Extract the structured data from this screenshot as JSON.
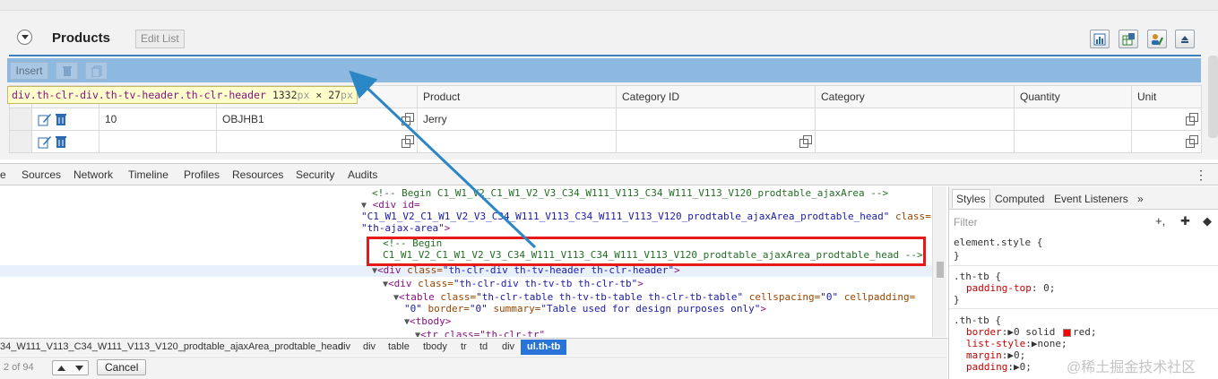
{
  "app": {
    "title": "Products",
    "edit_list_label": "Edit List",
    "insert_label": "Insert",
    "tooltip": {
      "selector": "div.th-clr-div.th-tv-header.th-clr-header",
      "width": "1332",
      "height": "27",
      "unit": "px",
      "times": "×"
    },
    "table": {
      "columns": [
        "Product",
        "Category ID",
        "Category",
        "Quantity",
        "Unit"
      ],
      "rows": [
        {
          "num": "10",
          "id": "OBJHB1",
          "product": "Jerry"
        },
        {
          "num": "",
          "id": "",
          "product": ""
        }
      ]
    }
  },
  "devtools": {
    "tabs": [
      "e",
      "Sources",
      "Network",
      "Timeline",
      "Profiles",
      "Resources",
      "Security",
      "Audits"
    ],
    "menu_icon": "⋮",
    "dom": {
      "l1": "<!-- Begin C1_W1_V2_C1_W1_V2_V3_C34_W111_V113_C34_W111_V113_V120_prodtable_ajaxArea -->",
      "l2_tag": "<div id=",
      "l3_val": "\"C1_W1_V2_C1_W1_V2_V3_C34_W111_V113_C34_W111_V113_V120_prodtable_ajaxArea_prodtable_head\"",
      "l3_attr": " class=",
      "l4_val": "\"th-ajax-area\"",
      "l4_tag": ">",
      "l5": "<!-- Begin",
      "l6": "C1_W1_V2_C1_W1_V2_V3_C34_W111_V113_C34_W111_V113_V120_prodtable_ajaxArea_prodtable_head -->",
      "l7_tag": "<div",
      "l7_attr": " class=",
      "l7_val": "\"th-clr-div th-tv-header th-clr-header\"",
      "l8_val": "\"th-clr-div th-tv-tb th-clr-tb\"",
      "l9_tag": "<table",
      "l9_val1": "\"th-clr-table th-tv-tb-table th-clr-tb-table\"",
      "l9_attr2": " cellspacing=",
      "l9_val2": "\"0\"",
      "l9_attr3": " cellpadding=",
      "l10_val1": "\"0\"",
      "l10_attr2": " border=",
      "l10_val2": "\"0\"",
      "l10_attr3": " summary=",
      "l10_val3": "\"Table used for design purposes only\"",
      "l11_tag": "<tbody>",
      "l12_tag": "<tr class=\"th-clr-tr\""
    },
    "breadcrumbs": [
      "34_W111_V113_C34_W111_V113_V120_prodtable_ajaxArea_prodtable_head",
      "div",
      "div",
      "table",
      "tbody",
      "tr",
      "td",
      "div"
    ],
    "breadcrumb_active": "ul.th-tb",
    "search_count": "2 of 94",
    "cancel_label": "Cancel",
    "styles": {
      "tabs": [
        "Styles",
        "Computed",
        "Event Listeners",
        "»"
      ],
      "filter_placeholder": "Filter",
      "tools": [
        "+,",
        "✚",
        "◆"
      ],
      "element_style": "element.style {",
      "brace_close": "}",
      "rule1_sel": ".th-tb {",
      "rule1_prop": "padding-top",
      "rule1_val": ": 0;",
      "rule2_sel": ".th-tb {",
      "rule2": [
        {
          "prop": "border",
          "val": ":▶0 solid ",
          "swatch": "#ff0000",
          "after": "red;"
        },
        {
          "prop": "list-style",
          "val": ":▶none;"
        },
        {
          "prop": "margin",
          "val": ":▶0;"
        },
        {
          "prop": "padding",
          "val": ":▶0;"
        }
      ]
    }
  },
  "watermark": "@稀土掘金技术社区",
  "colors": {
    "accent": "#3c7fc0",
    "header_bar": "#8db8e0",
    "highlight_box": "#e8191b",
    "arrow": "#2b86c5"
  }
}
